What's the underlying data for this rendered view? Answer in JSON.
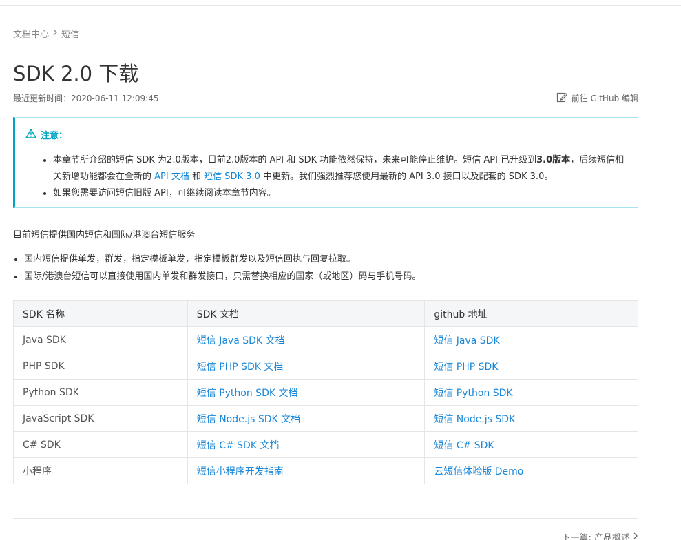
{
  "breadcrumb": {
    "root": "文档中心",
    "current": "短信"
  },
  "title": "SDK 2.0 下载",
  "meta": {
    "updated_label": "最近更新时间：",
    "updated_time": "2020-06-11 12:09:45"
  },
  "edit": {
    "label": "前往 GitHub 编辑"
  },
  "notice": {
    "title": "注意：",
    "item1_a": "本章节所介绍的短信 SDK 为2.0版本，目前2.0版本的 API 和 SDK 功能依然保持，未来可能停止维护。短信 API 已升级到",
    "item1_bold": "3.0版本",
    "item1_b": "，后续短信相关新增功能都会在全新的 ",
    "item1_link1": "API 文档",
    "item1_c": " 和 ",
    "item1_link2": "短信 SDK 3.0",
    "item1_d": " 中更新。我们强烈推荐您使用最新的 API 3.0 接口以及配套的 SDK 3.0。",
    "item2": "如果您需要访问短信旧版 API，可继续阅读本章节内容。"
  },
  "intro": "目前短信提供国内短信和国际/港澳台短信服务。",
  "bullets": [
    "国内短信提供单发，群发，指定模板单发，指定模板群发以及短信回执与回复拉取。",
    "国际/港澳台短信可以直接使用国内单发和群发接口，只需替换相应的国家（或地区）码与手机号码。"
  ],
  "table": {
    "headers": [
      "SDK 名称",
      "SDK 文档",
      "github 地址"
    ],
    "rows": [
      [
        "Java SDK",
        "短信 Java SDK 文档",
        "短信 Java SDK"
      ],
      [
        "PHP SDK",
        "短信 PHP SDK 文档",
        "短信 PHP SDK"
      ],
      [
        "Python SDK",
        "短信 Python SDK 文档",
        "短信 Python SDK"
      ],
      [
        "JavaScript SDK",
        "短信 Node.js SDK 文档",
        "短信 Node.js SDK"
      ],
      [
        "C# SDK",
        "短信 C# SDK 文档",
        "短信 C# SDK"
      ],
      [
        "小程序",
        "短信小程序开发指南",
        "云短信体验版 Demo"
      ]
    ]
  },
  "next": {
    "label": "下一篇: 产品概述"
  }
}
